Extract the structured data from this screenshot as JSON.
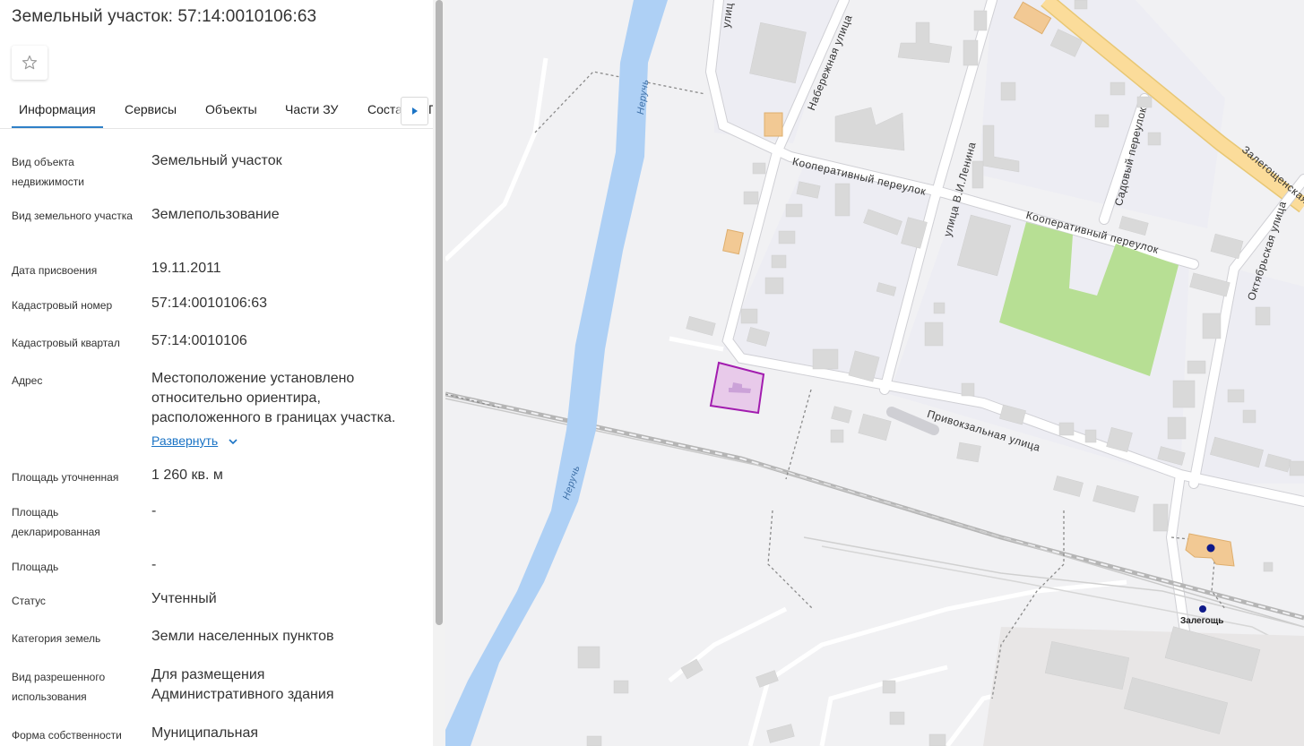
{
  "panel": {
    "title": "Земельный участок: 57:14:0010106:63",
    "favorite_icon": "star-outline-icon"
  },
  "tabs": [
    "Информация",
    "Сервисы",
    "Объекты",
    "Части ЗУ",
    "Соста"
  ],
  "tabs_cut": "Г",
  "rows": [
    {
      "label": "Вид объекта недвижимости",
      "value": "Земельный участок"
    },
    {
      "label": "Вид земельного участка",
      "value": "Землепользование"
    },
    {
      "label": "Дата присвоения",
      "value": "19.11.2011"
    },
    {
      "label": "Кадастровый номер",
      "value": "57:14:0010106:63"
    },
    {
      "label": "Кадастровый квартал",
      "value": "57:14:0010106"
    },
    {
      "label": "Адрес",
      "value": "Местоположение установлено относительно ориентира, расположенного в границах участка."
    },
    {
      "label": "Площадь уточненная",
      "value": "1 260 кв. м"
    },
    {
      "label": "Площадь декларированная",
      "value": "-"
    },
    {
      "label": "Площадь",
      "value": "-"
    },
    {
      "label": "Статус",
      "value": "Учтенный"
    },
    {
      "label": "Категория земель",
      "value": "Земли населенных пунктов"
    },
    {
      "label": "Вид разрешенного использования",
      "value": "Для размещения Административного здания"
    },
    {
      "label": "Форма собственности",
      "value": "Муниципальная"
    }
  ],
  "expand_link": "Развернуть",
  "map": {
    "streets": {
      "ulitsa_top": "улиц",
      "naberezhnaya": "Набережная улица",
      "kooperativny_1": "Кооперативный переулок",
      "lenina": "улица В.И.Ленина",
      "kooperativny_2": "Кооперативный переулок",
      "sadovy": "Садовый переулок",
      "oktyabrskaya": "Октябрьская улица",
      "zalegoshchenskaya": "Залегощенская",
      "privokzalnaya": "Привокзальная улица"
    },
    "river_labels": [
      "Неручь",
      "Неручь"
    ],
    "station": "Залегощь",
    "colors": {
      "background": "#f1f1f3",
      "river": "#aed0f5",
      "park": "#b7df94",
      "highway": "#fbdc9a",
      "parcel": "#a21caf",
      "building": "#d9d9d9",
      "orange_building": "#f2c994"
    }
  }
}
